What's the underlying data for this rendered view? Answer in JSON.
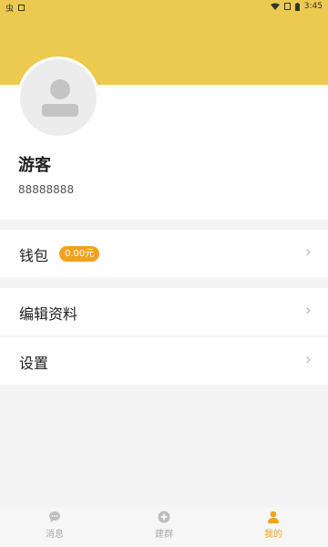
{
  "status_bar": {
    "left_text": "虫",
    "time": "3:45"
  },
  "profile": {
    "name": "游客",
    "id": "88888888"
  },
  "wallet": {
    "label": "钱包",
    "balance": "0.00元"
  },
  "menu": {
    "edit_profile": "编辑资料",
    "settings": "设置"
  },
  "tabs": [
    {
      "label": "消息",
      "icon": "message-icon"
    },
    {
      "label": "建群",
      "icon": "add-group-icon"
    },
    {
      "label": "我的",
      "icon": "person-icon"
    }
  ],
  "colors": {
    "accent": "#ecca4f",
    "badge": "#f0a21e",
    "active_tab": "#f0a21e",
    "inactive_tab": "#aaaaaa"
  }
}
